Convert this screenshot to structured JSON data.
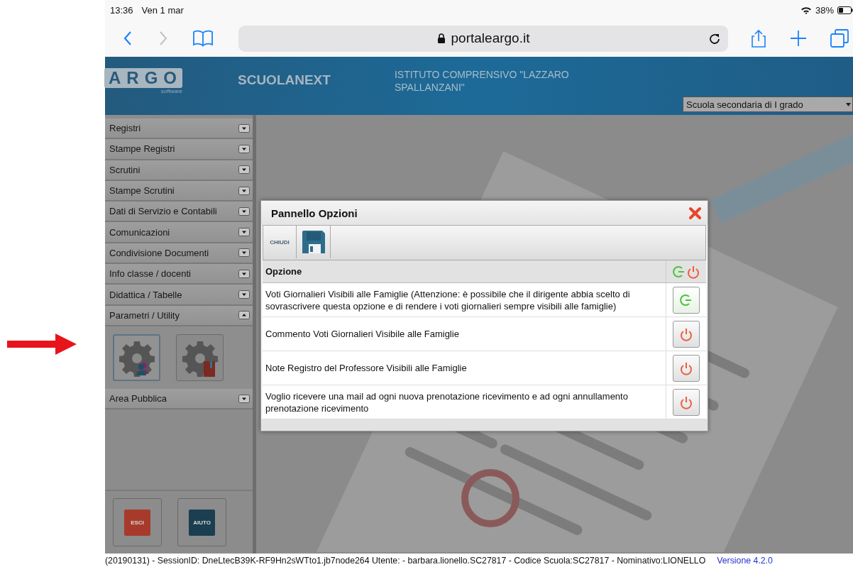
{
  "device_status": {
    "time": "13:36",
    "date": "Ven 1 mar",
    "battery": "38%"
  },
  "browser": {
    "url": "portaleargo.it",
    "back_enabled": true,
    "forward_enabled": false
  },
  "header": {
    "logo": "ARGO",
    "logo_sub": "software",
    "product": "SCUOLANEXT",
    "school": "ISTITUTO COMPRENSIVO \"LAZZARO SPALLANZANI\"",
    "school_level": "Scuola secondaria di I grado"
  },
  "sidebar": {
    "items": [
      {
        "label": "Registri",
        "expanded": false
      },
      {
        "label": "Stampe Registri",
        "expanded": false
      },
      {
        "label": "Scrutini",
        "expanded": false
      },
      {
        "label": "Stampe Scrutini",
        "expanded": false
      },
      {
        "label": "Dati di Servizio e Contabili",
        "expanded": false
      },
      {
        "label": "Comunicazioni",
        "expanded": false
      },
      {
        "label": "Condivisione Documenti",
        "expanded": false
      },
      {
        "label": "Info classe / docenti",
        "expanded": false
      },
      {
        "label": "Didattica / Tabelle",
        "expanded": false
      },
      {
        "label": "Parametri / Utility",
        "expanded": true,
        "tools": [
          {
            "kind": "users",
            "selected": true
          },
          {
            "kind": "book",
            "selected": false
          }
        ]
      },
      {
        "label": "Area Pubblica",
        "expanded": false
      }
    ],
    "buttons": [
      {
        "label": "ESCI",
        "kind": "exit"
      },
      {
        "label": "AIUTO",
        "kind": "help"
      }
    ]
  },
  "dialog": {
    "title": "Pannello Opzioni",
    "close_label": "CHIUDI",
    "column": "Opzione",
    "options": [
      {
        "label": "Voti Giornalieri Visibili alle Famiglie (Attenzione: è possibile che il dirigente abbia scelto di sovrascrivere questa opzione e di rendere i voti giornalieri sempre visibili alle famiglie)",
        "on": true
      },
      {
        "label": "Commento Voti Giornalieri Visibile alle Famiglie",
        "on": false
      },
      {
        "label": "Note Registro del Professore Visibili alle Famiglie",
        "on": false
      },
      {
        "label": "Voglio ricevere una mail ad ogni nuova prenotazione ricevimento e ad ogni annullamento prenotazione ricevimento",
        "on": false
      }
    ]
  },
  "status_line": {
    "text": "(20190131) - SessionID: DneLtecB39K-RF9Hn2sWTto1.jb7node264 Utente: - barbara.lionello.SC27817 - Codice Scuola:SC27817 - Nominativo:LIONELLO",
    "version": "Versione 4.2.0"
  }
}
